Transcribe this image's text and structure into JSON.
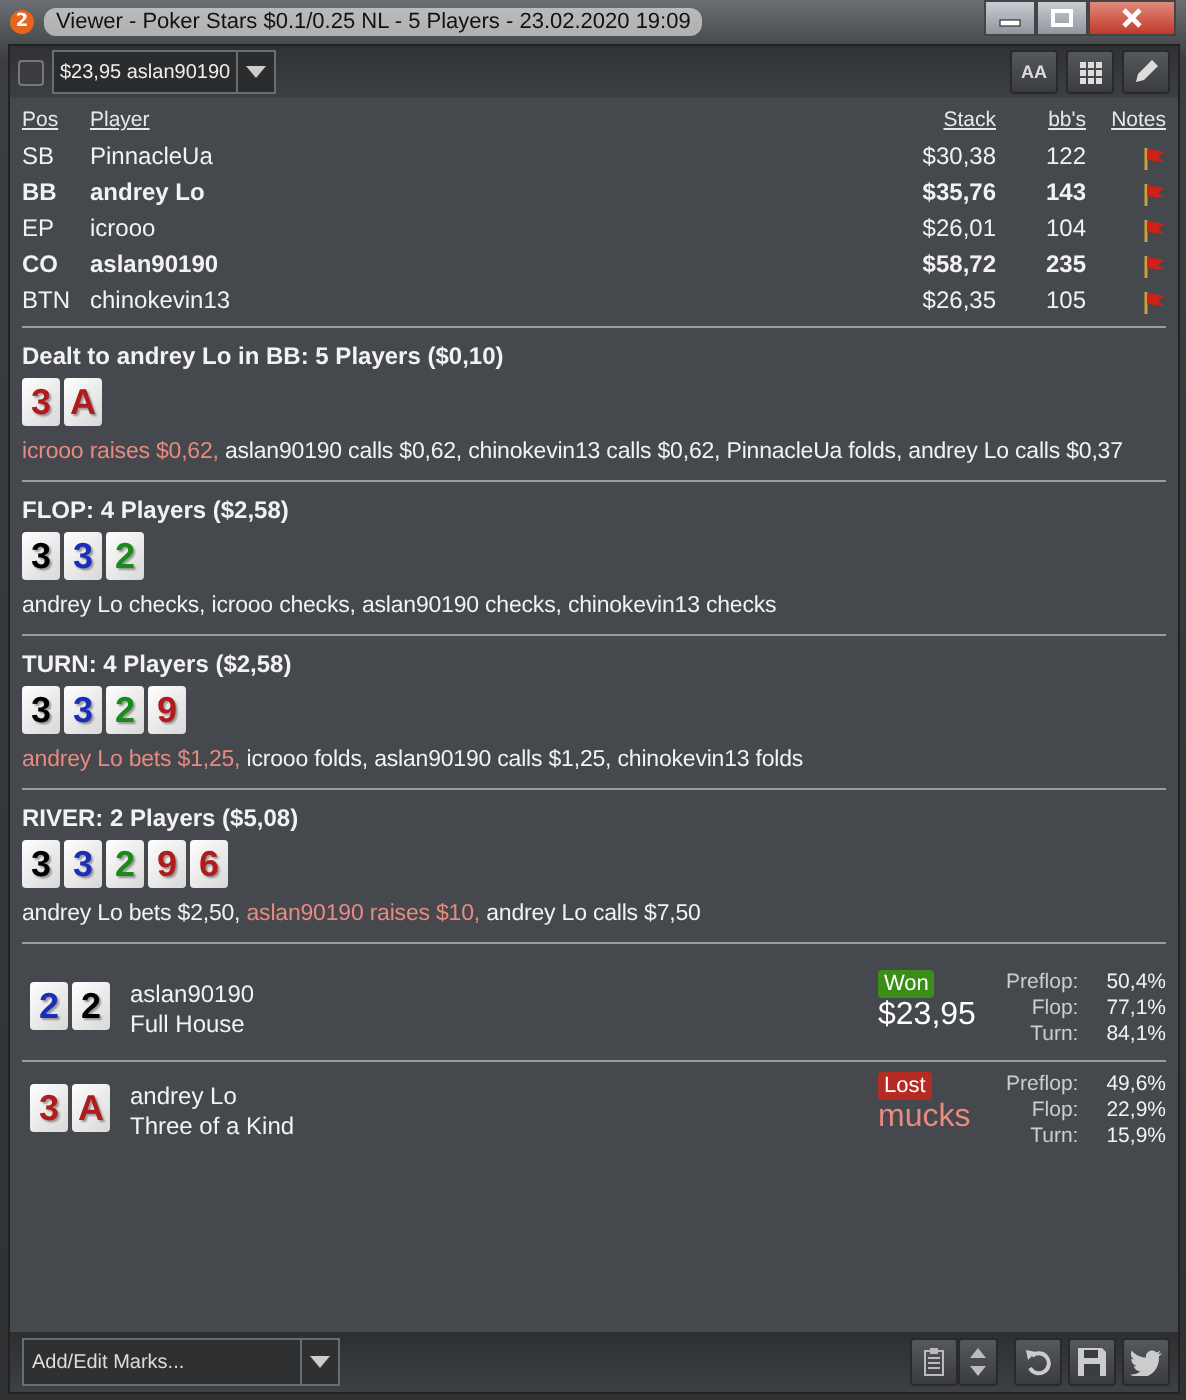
{
  "window": {
    "app_badge": "2",
    "title": "Viewer - Poker Stars $0.1/0.25 NL - 5 Players - 23.02.2020 19:09"
  },
  "toolbar": {
    "checkbox": {
      "checked": false
    },
    "hand_select": {
      "value": "$23,95 aslan90190"
    },
    "font_button": "AA"
  },
  "players_table": {
    "columns": [
      "Pos",
      "Player",
      "Stack",
      "bb's",
      "Notes"
    ],
    "rows": [
      {
        "pos": "SB",
        "player": "PinnacleUa",
        "stack": "$30,38",
        "bbs": "122",
        "highlighted": false
      },
      {
        "pos": "BB",
        "player": "andrey Lo",
        "stack": "$35,76",
        "bbs": "143",
        "highlighted": true
      },
      {
        "pos": "EP",
        "player": "icrooo",
        "stack": "$26,01",
        "bbs": "104",
        "highlighted": false
      },
      {
        "pos": "CO",
        "player": "aslan90190",
        "stack": "$58,72",
        "bbs": "235",
        "highlighted": true
      },
      {
        "pos": "BTN",
        "player": "chinokevin13",
        "stack": "$26,35",
        "bbs": "105",
        "highlighted": false
      }
    ]
  },
  "streets": [
    {
      "heading": "Dealt to andrey Lo in BB: 5 Players ($0,10)",
      "cards": [
        {
          "rank": "3",
          "color": "#b01c1c"
        },
        {
          "rank": "A",
          "color": "#b01c1c"
        }
      ],
      "actions": [
        {
          "text": "icrooo raises $0,62,",
          "aggressive": true
        },
        {
          "text": "aslan90190 calls $0,62,",
          "aggressive": false
        },
        {
          "text": "chinokevin13 calls $0,62,",
          "aggressive": false
        },
        {
          "text": "PinnacleUa folds,",
          "aggressive": false
        },
        {
          "text": "andrey Lo calls $0,37",
          "aggressive": false
        }
      ]
    },
    {
      "heading": "FLOP: 4 Players ($2,58)",
      "cards": [
        {
          "rank": "3",
          "color": "#000000"
        },
        {
          "rank": "3",
          "color": "#1a2fb5"
        },
        {
          "rank": "2",
          "color": "#1a8a1a"
        }
      ],
      "actions": [
        {
          "text": "andrey Lo checks,",
          "aggressive": false
        },
        {
          "text": "icrooo checks,",
          "aggressive": false
        },
        {
          "text": "aslan90190 checks,",
          "aggressive": false
        },
        {
          "text": "chinokevin13 checks",
          "aggressive": false
        }
      ]
    },
    {
      "heading": "TURN: 4 Players ($2,58)",
      "cards": [
        {
          "rank": "3",
          "color": "#000000"
        },
        {
          "rank": "3",
          "color": "#1a2fb5"
        },
        {
          "rank": "2",
          "color": "#1a8a1a"
        },
        {
          "rank": "9",
          "color": "#b01c1c"
        }
      ],
      "actions": [
        {
          "text": "andrey Lo bets $1,25,",
          "aggressive": true
        },
        {
          "text": "icrooo folds,",
          "aggressive": false
        },
        {
          "text": "aslan90190 calls $1,25,",
          "aggressive": false
        },
        {
          "text": "chinokevin13 folds",
          "aggressive": false
        }
      ]
    },
    {
      "heading": "RIVER: 2 Players ($5,08)",
      "cards": [
        {
          "rank": "3",
          "color": "#000000"
        },
        {
          "rank": "3",
          "color": "#1a2fb5"
        },
        {
          "rank": "2",
          "color": "#1a8a1a"
        },
        {
          "rank": "9",
          "color": "#b01c1c"
        },
        {
          "rank": "6",
          "color": "#b01c1c"
        }
      ],
      "actions": [
        {
          "text": "andrey Lo bets $2,50,",
          "aggressive": false
        },
        {
          "text": "aslan90190 raises $10,",
          "aggressive": true
        },
        {
          "text": "andrey Lo calls $7,50",
          "aggressive": false
        }
      ]
    }
  ],
  "showdown": [
    {
      "cards": [
        {
          "rank": "2",
          "color": "#1a2fb5"
        },
        {
          "rank": "2",
          "color": "#000000"
        }
      ],
      "player": "aslan90190",
      "hand": "Full House",
      "kind": "won",
      "badge": "Won",
      "amount": "$23,95",
      "equity": [
        {
          "label": "Preflop:",
          "value": "50,4%"
        },
        {
          "label": "Flop:",
          "value": "77,1%"
        },
        {
          "label": "Turn:",
          "value": "84,1%"
        }
      ]
    },
    {
      "cards": [
        {
          "rank": "3",
          "color": "#b01c1c"
        },
        {
          "rank": "A",
          "color": "#b01c1c"
        }
      ],
      "player": "andrey Lo",
      "hand": "Three of a Kind",
      "kind": "lost",
      "badge": "Lost",
      "amount": "mucks",
      "equity": [
        {
          "label": "Preflop:",
          "value": "49,6%"
        },
        {
          "label": "Flop:",
          "value": "22,9%"
        },
        {
          "label": "Turn:",
          "value": "15,9%"
        }
      ]
    }
  ],
  "footer": {
    "marks_select": {
      "placeholder": "Add/Edit Marks..."
    }
  }
}
